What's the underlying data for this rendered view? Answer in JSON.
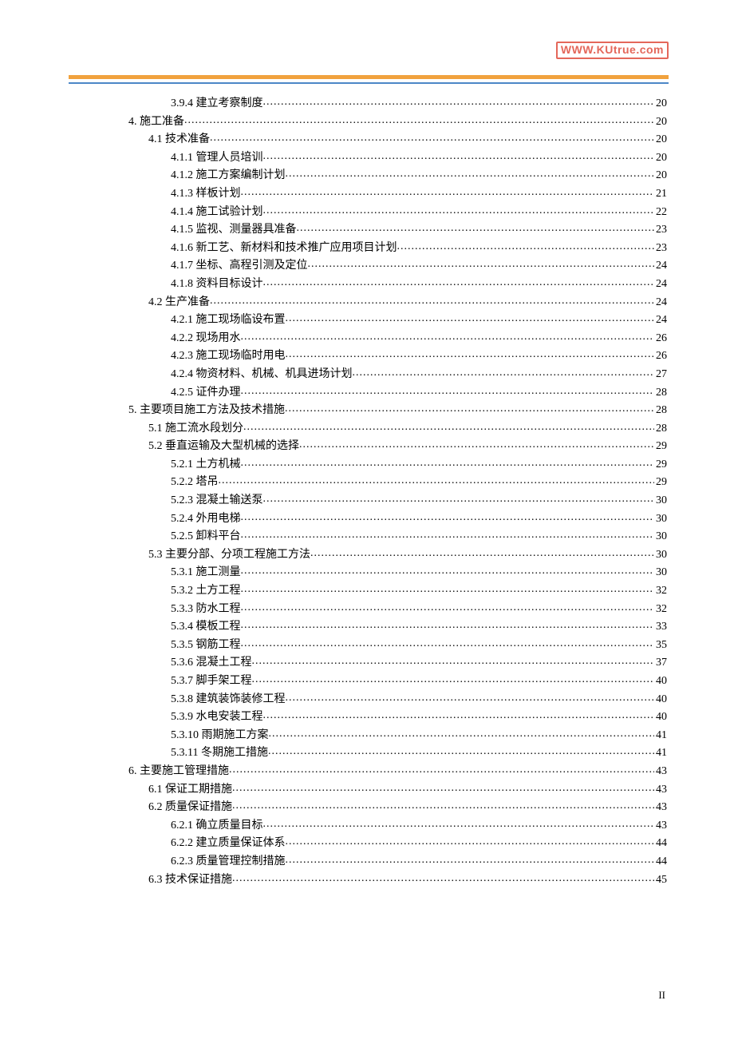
{
  "stamp": "WWW.KUtrue.com",
  "page_number": "II",
  "toc": [
    {
      "indent": 2,
      "label": "3.9.4 建立考察制度",
      "page": "20"
    },
    {
      "indent": 0,
      "label": "4.  施工准备",
      "page": "20"
    },
    {
      "indent": 1,
      "label": "4.1  技术准备",
      "page": "20"
    },
    {
      "indent": 2,
      "label": "4.1.1  管理人员培训",
      "page": "20"
    },
    {
      "indent": 2,
      "label": "4.1.2  施工方案编制计划",
      "page": "20"
    },
    {
      "indent": 2,
      "label": "4.1.3  样板计划",
      "page": "21"
    },
    {
      "indent": 2,
      "label": "4.1.4 施工试验计划",
      "page": "22"
    },
    {
      "indent": 2,
      "label": "4.1.5 监视、测量器具准备",
      "page": "23"
    },
    {
      "indent": 2,
      "label": "4.1.6 新工艺、新材料和技术推广应用项目计划",
      "page": "23"
    },
    {
      "indent": 2,
      "label": "4.1.7 坐标、高程引测及定位",
      "page": "24"
    },
    {
      "indent": 2,
      "label": "4.1.8 资料目标设计",
      "page": "24"
    },
    {
      "indent": 1,
      "label": "4.2 生产准备",
      "page": "24"
    },
    {
      "indent": 2,
      "label": "4.2.1 施工现场临设布置",
      "page": "24"
    },
    {
      "indent": 2,
      "label": "4.2.2 现场用水",
      "page": "26"
    },
    {
      "indent": 2,
      "label": "4.2.3 施工现场临时用电",
      "page": "26"
    },
    {
      "indent": 2,
      "label": "4.2.4 物资材料、机械、机具进场计划",
      "page": "27"
    },
    {
      "indent": 2,
      "label": "4.2.5 证件办理",
      "page": "28"
    },
    {
      "indent": 0,
      "label": "5.  主要项目施工方法及技术措施",
      "page": "28"
    },
    {
      "indent": 1,
      "label": "5.1  施工流水段划分",
      "page": "28"
    },
    {
      "indent": 1,
      "label": "5.2  垂直运输及大型机械的选择",
      "page": "29"
    },
    {
      "indent": 2,
      "label": "5.2.1 土方机械",
      "page": "29"
    },
    {
      "indent": 2,
      "label": "5.2.2  塔吊",
      "page": "29"
    },
    {
      "indent": 2,
      "label": "5.2.3 混凝土输送泵",
      "page": "30"
    },
    {
      "indent": 2,
      "label": "5.2.4 外用电梯",
      "page": "30"
    },
    {
      "indent": 2,
      "label": "5.2.5 卸料平台",
      "page": "30"
    },
    {
      "indent": 1,
      "label": "5.3  主要分部、分项工程施工方法",
      "page": "30"
    },
    {
      "indent": 2,
      "label": "5.3.1 施工测量",
      "page": "30"
    },
    {
      "indent": 2,
      "label": "5.3.2  土方工程",
      "page": "32"
    },
    {
      "indent": 2,
      "label": "5.3.3  防水工程",
      "page": "32"
    },
    {
      "indent": 2,
      "label": "5.3.4 模板工程",
      "page": "33"
    },
    {
      "indent": 2,
      "label": "5.3.5 钢筋工程",
      "page": "35"
    },
    {
      "indent": 2,
      "label": "5.3.6  混凝土工程",
      "page": "37"
    },
    {
      "indent": 2,
      "label": "5.3.7  脚手架工程",
      "page": "40"
    },
    {
      "indent": 2,
      "label": "5.3.8  建筑装饰装修工程",
      "page": "40"
    },
    {
      "indent": 2,
      "label": "5.3.9 水电安装工程",
      "page": "40"
    },
    {
      "indent": 2,
      "label": "5.3.10 雨期施工方案",
      "page": "41"
    },
    {
      "indent": 2,
      "label": "5.3.11 冬期施工措施",
      "page": "41"
    },
    {
      "indent": 0,
      "label": "6.  主要施工管理措施",
      "page": "43"
    },
    {
      "indent": 1,
      "label": "6.1 保证工期措施",
      "page": "43"
    },
    {
      "indent": 1,
      "label": "6.2 质量保证措施",
      "page": "43"
    },
    {
      "indent": 2,
      "label": "6.2.1 确立质量目标",
      "page": "43"
    },
    {
      "indent": 2,
      "label": "6.2.2 建立质量保证体系",
      "page": "44"
    },
    {
      "indent": 2,
      "label": "6.2.3 质量管理控制措施",
      "page": "44"
    },
    {
      "indent": 1,
      "label": "6.3 技术保证措施",
      "page": "45"
    }
  ]
}
